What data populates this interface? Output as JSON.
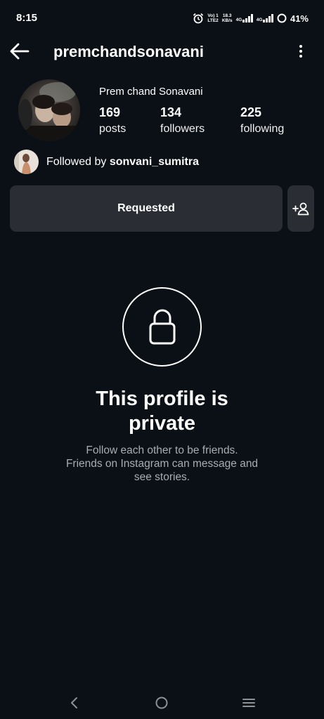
{
  "status_bar": {
    "time": "8:15",
    "net1_line1": "Vo) 1",
    "net1_line2": "LTE2",
    "speed_line1": "18.3",
    "speed_line2": "KB/s",
    "sim1_type": "4G",
    "sim2_type": "4G",
    "battery": "41%"
  },
  "header": {
    "username": "premchandsonavani"
  },
  "profile": {
    "full_name": "Prem chand Sonavani",
    "stats": [
      {
        "value": "169",
        "label": "posts"
      },
      {
        "value": "134",
        "label": "followers"
      },
      {
        "value": "225",
        "label": "following"
      }
    ],
    "followed_by_prefix": "Followed by ",
    "followed_by_user": "sonvani_sumitra"
  },
  "actions": {
    "requested_label": "Requested"
  },
  "private_notice": {
    "title": "This profile is private",
    "line1": "Follow each other to be friends.",
    "line2": "Friends on Instagram can message and",
    "line3": "see stories."
  },
  "colors": {
    "background": "#0b1016",
    "button_bg": "#2a2e34",
    "secondary_text": "#a8adb3"
  }
}
